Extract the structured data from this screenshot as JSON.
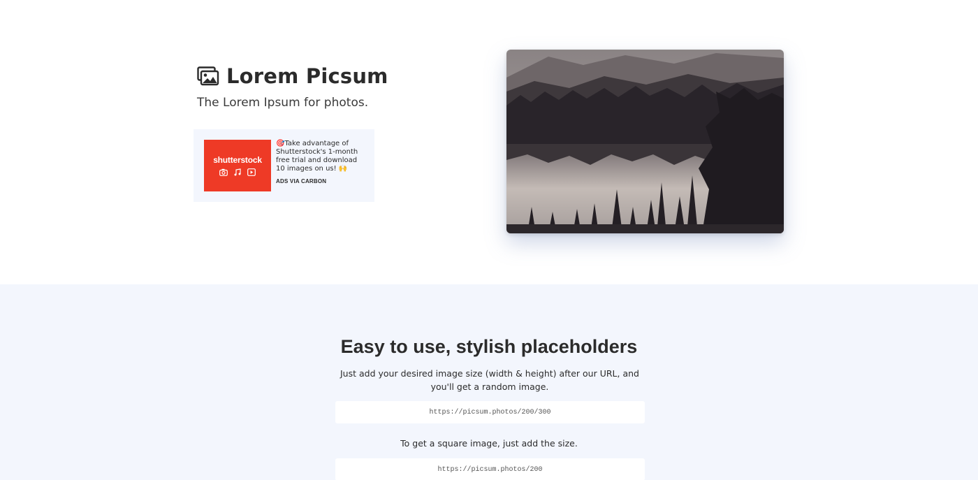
{
  "header": {
    "brand_icon": "images-icon",
    "title": "Lorem Picsum",
    "tagline": "The Lorem Ipsum for photos."
  },
  "ad": {
    "logo_text": "shutterstock",
    "logo_icons": [
      "camera-icon",
      "music-icon",
      "play-icon"
    ],
    "text": "🎯Take advantage of Shutterstock's 1-month free trial and download 10 images on us! 🙌",
    "via": "ADS VIA CARBON",
    "brand_color": "#ee3a26"
  },
  "hero_image": {
    "description_icon": "landscape-photo"
  },
  "features": {
    "title": "Easy to use, stylish placeholders",
    "description": "Just add your desired image size (width & height) after our URL, and you'll get a random image.",
    "example_url_1": "https://picsum.photos/200/300",
    "square_text": "To get a square image, just add the size.",
    "example_url_2": "https://picsum.photos/200"
  },
  "colors": {
    "background": "#ffffff",
    "section_background": "#f3f6fd",
    "text": "#2b2b2b"
  }
}
